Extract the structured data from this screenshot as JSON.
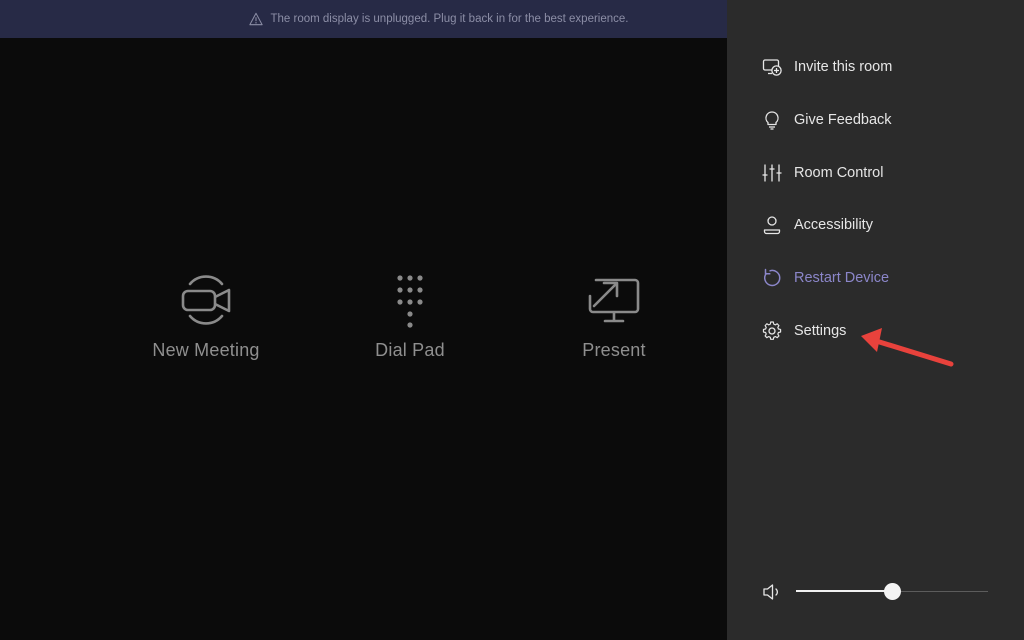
{
  "banner": {
    "message": "The room display is unplugged. Plug it back in for the best experience.",
    "icon": "warning-icon"
  },
  "actions": [
    {
      "label": "New Meeting",
      "icon": "video-camera-icon"
    },
    {
      "label": "Dial Pad",
      "icon": "dial-pad-icon"
    },
    {
      "label": "Present",
      "icon": "present-screen-icon"
    }
  ],
  "menu": {
    "items": [
      {
        "label": "Invite this room",
        "icon": "invite-room-icon"
      },
      {
        "label": "Give Feedback",
        "icon": "lightbulb-icon"
      },
      {
        "label": "Room Control",
        "icon": "sliders-icon"
      },
      {
        "label": "Accessibility",
        "icon": "accessibility-icon"
      },
      {
        "label": "Restart Device",
        "icon": "restart-icon",
        "state": "disabled"
      },
      {
        "label": "Settings",
        "icon": "gear-icon"
      }
    ]
  },
  "volume": {
    "icon": "speaker-icon",
    "level": 0.5
  },
  "colors": {
    "banner_bg": "#272a46",
    "sidebar_bg": "#2b2b2b",
    "main_bg": "#0b0b0b",
    "disabled_accent": "#8b86c9",
    "annotation_arrow": "#e8423c"
  }
}
